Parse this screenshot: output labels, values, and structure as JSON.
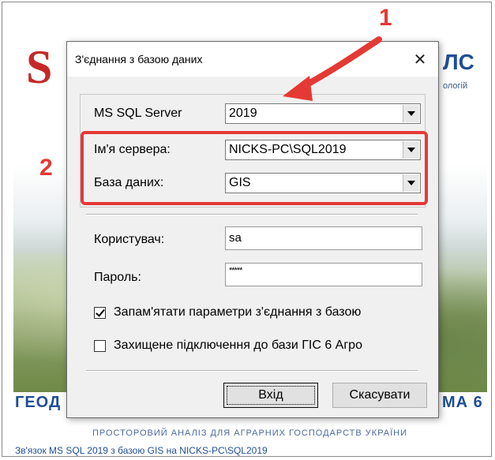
{
  "background": {
    "logo_letter": "S",
    "brand_right": "ЛС",
    "brand_right_sub": "ологій",
    "geo_left": "ГЕОД",
    "geo_right": "МА 6",
    "subtitle": "ПРОСТОРОВИЙ АНАЛІЗ ДЛЯ АГРАРНИХ ГОСПОДАРСТВ УКРАЇНИ",
    "status_line": "Зв'язок MS SQL 2019 з базою GIS на NICKS-PC\\SQL2019"
  },
  "annotations": {
    "step1": "1",
    "step2": "2",
    "color": "#e53935"
  },
  "dialog": {
    "title": "З'єднання з базою даних",
    "close_glyph": "✕",
    "fields": {
      "ms_sql_server": {
        "label": "MS SQL Server",
        "value": "2019"
      },
      "server_name": {
        "label": "Ім'я сервера:",
        "value": "NICKS-PC\\SQL2019"
      },
      "database": {
        "label": "База даних:",
        "value": "GIS"
      },
      "user": {
        "label": "Користувач:",
        "value": "sa"
      },
      "password": {
        "label": "Пароль:",
        "value": "*****"
      }
    },
    "checkboxes": {
      "remember": {
        "label": "Запам'ятати параметри з'єднання з базою",
        "checked": true
      },
      "secure": {
        "label": "Захищене підключення до бази ГІС 6 Агро",
        "checked": false
      }
    },
    "buttons": {
      "ok": "Вхід",
      "cancel": "Скасувати"
    }
  }
}
